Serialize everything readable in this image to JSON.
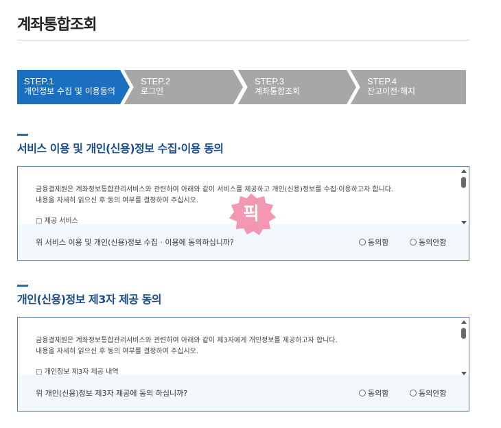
{
  "page": {
    "title": "계좌통합조회"
  },
  "steps": [
    {
      "number": "STEP.1",
      "label": "개인정보 수집 및 이용동의",
      "active": true
    },
    {
      "number": "STEP.2",
      "label": "로그인",
      "active": false
    },
    {
      "number": "STEP.3",
      "label": "계좌통합조회",
      "active": false
    },
    {
      "number": "STEP.4",
      "label": "잔고이전·해지",
      "active": false
    }
  ],
  "colors": {
    "active_step": "#1b6fc0",
    "inactive_step": "#a7a7a7",
    "title_blue": "#1b4e8c",
    "watermark": "#f28cab"
  },
  "section1": {
    "title": "서비스 이용 및 개인(신용)정보 수집·이용 동의",
    "body_line1": "금융결제원은 계좌정보통합관리서비스와 관련하여 아래와 같이 서비스를 제공하고 개인(신용)정보를 수집·이용하고자 합니다.",
    "body_line2": "내용을 자세히 읽으신 후 동의 여부를 결정하여 주십시오.",
    "item": "제공 서비스",
    "question": "위 서비스 이용 및 개인(신용)정보 수집 · 이용에 동의하십니까?",
    "agree": "동의함",
    "disagree": "동의안함"
  },
  "section2": {
    "title": "개인(신용)정보 제3자 제공 동의",
    "body_line1": "금융결제원은 계좌정보통합관리서비스와 관련하여 아래와 같이 제3자에게 개인정보를 제공하고자 합니다.",
    "body_line2": "내용을 자세히 읽으신 후 동의 여부를 결정하여 주십시오.",
    "item": "개인정보 제3자 제공 내역",
    "question": "위 개인(신용)정보 제3자 제공에 동의 하십니까?",
    "agree": "동의함",
    "disagree": "동의안함"
  },
  "watermark": {
    "text": "픽",
    "icon": "badge-icon"
  }
}
